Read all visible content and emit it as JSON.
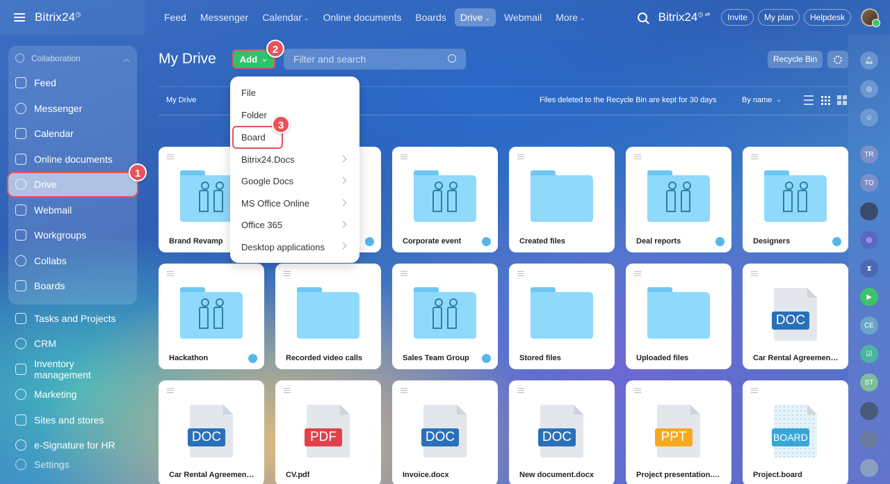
{
  "topbar": {
    "logo": "Bitrix24",
    "nav": [
      {
        "label": "Feed",
        "name": "nav-feed",
        "caret": false,
        "active": false
      },
      {
        "label": "Messenger",
        "name": "nav-messenger",
        "caret": false,
        "active": false
      },
      {
        "label": "Calendar",
        "name": "nav-calendar",
        "caret": true,
        "active": false
      },
      {
        "label": "Online documents",
        "name": "nav-online-documents",
        "caret": false,
        "active": false
      },
      {
        "label": "Boards",
        "name": "nav-boards",
        "caret": false,
        "active": false
      },
      {
        "label": "Drive",
        "name": "nav-drive",
        "caret": true,
        "active": true
      },
      {
        "label": "Webmail",
        "name": "nav-webmail",
        "caret": false,
        "active": false
      },
      {
        "label": "More",
        "name": "nav-more",
        "caret": true,
        "active": false
      }
    ],
    "brand_right": "Bitrix24",
    "buttons": [
      "Invite",
      "My plan",
      "Helpdesk"
    ]
  },
  "sidebar": {
    "group_label": "Collaboration",
    "group_items": [
      "Feed",
      "Messenger",
      "Calendar",
      "Online documents",
      "Drive",
      "Webmail",
      "Workgroups",
      "Collabs",
      "Boards"
    ],
    "items": [
      "Tasks and Projects",
      "CRM",
      "Inventory management",
      "Marketing",
      "Sites and stores",
      "e-Signature for HR"
    ],
    "settings": "Settings"
  },
  "main": {
    "title": "My Drive",
    "add_label": "Add",
    "filter_placeholder": "Filter and search",
    "recycle_bin": "Recycle Bin",
    "breadcrumb": "My Drive",
    "notice": "Files deleted to the Recycle Bin are kept for 30 days",
    "sort": "By name"
  },
  "add_menu": [
    {
      "label": "File",
      "submenu": false
    },
    {
      "label": "Folder",
      "submenu": false
    },
    {
      "label": "Board",
      "submenu": false
    },
    {
      "label": "Bitrix24.Docs",
      "submenu": true
    },
    {
      "label": "Google Docs",
      "submenu": true
    },
    {
      "label": "MS Office Online",
      "submenu": true
    },
    {
      "label": "Office 365",
      "submenu": true
    },
    {
      "label": "Desktop applications",
      "submenu": true
    }
  ],
  "steps": [
    "1",
    "2",
    "3"
  ],
  "items": [
    {
      "name": "Brand Revamp",
      "kind": "folder",
      "shared": true
    },
    {
      "name": "",
      "kind": "folder",
      "shared": true
    },
    {
      "name": "Corporate event",
      "kind": "folder",
      "shared": true
    },
    {
      "name": "Created files",
      "kind": "folder",
      "shared": false
    },
    {
      "name": "Deal reports",
      "kind": "folder",
      "shared": true
    },
    {
      "name": "Designers",
      "kind": "folder",
      "shared": true
    },
    {
      "name": "Hackathon",
      "kind": "folder",
      "shared": true
    },
    {
      "name": "Recorded video calls",
      "kind": "folder",
      "shared": false
    },
    {
      "name": "Sales Team Group",
      "kind": "folder",
      "shared": true
    },
    {
      "name": "Stored files",
      "kind": "folder",
      "shared": false
    },
    {
      "name": "Uploaded files",
      "kind": "folder",
      "shared": false
    },
    {
      "name": "Car Rental Agreement ...",
      "kind": "file",
      "badge": "DOC"
    },
    {
      "name": "Car Rental Agreement....",
      "kind": "file",
      "badge": "DOC"
    },
    {
      "name": "CV.pdf",
      "kind": "file",
      "badge": "PDF"
    },
    {
      "name": "Invoice.docx",
      "kind": "file",
      "badge": "DOC"
    },
    {
      "name": "New document.docx",
      "kind": "file",
      "badge": "DOC"
    },
    {
      "name": "Project presentation.p...",
      "kind": "file",
      "badge": "PPT"
    },
    {
      "name": "Project.board",
      "kind": "file",
      "badge": "BOARD"
    }
  ],
  "rail": [
    "TR",
    "TO",
    "CE",
    "ST"
  ],
  "colors": {
    "accent": "#2fc26c",
    "highlight": "#e8525a",
    "folder": "#8fd9fb"
  }
}
